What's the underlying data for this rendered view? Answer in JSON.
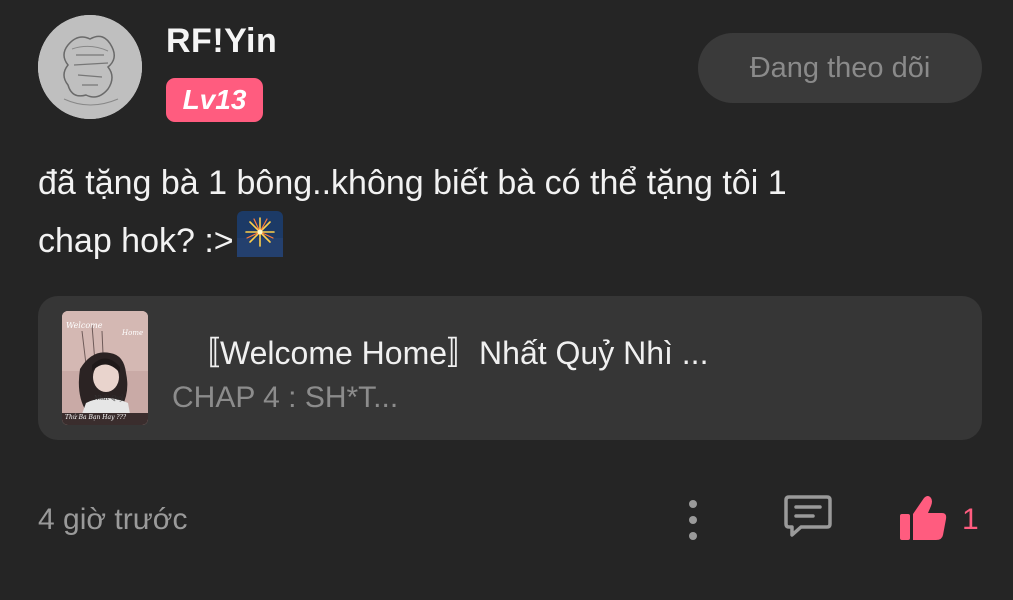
{
  "post": {
    "username": "RF!Yin",
    "level": "Lv13",
    "follow_label": "Đang theo dõi",
    "comment_line1": "đã tặng bà 1 bông..không biết bà có thể tặng tôi 1",
    "comment_line2": "chap hok? :>",
    "comment_emoji": "sparkler-fireworks-icon",
    "timestamp": "4 giờ trước",
    "like_count": "1"
  },
  "chapter_card": {
    "title": "〚Welcome Home〛Nhất Quỷ Nhì ...",
    "subtitle": "CHAP 4 : SH*T...",
    "cover_text_top_left": "Welcome",
    "cover_text_top_right": "Home",
    "cover_text_middle": "Nhất Quỷ",
    "cover_text_bottom": "Thứ Ba Bạn Hay ???"
  },
  "colors": {
    "background": "#252525",
    "accent": "#ff5c7f",
    "card": "#363636",
    "button": "#3a3a3a"
  },
  "icons": [
    "avatar",
    "sparkler-fireworks-icon",
    "more-vertical-icon",
    "comment-icon",
    "thumbs-up-icon"
  ]
}
